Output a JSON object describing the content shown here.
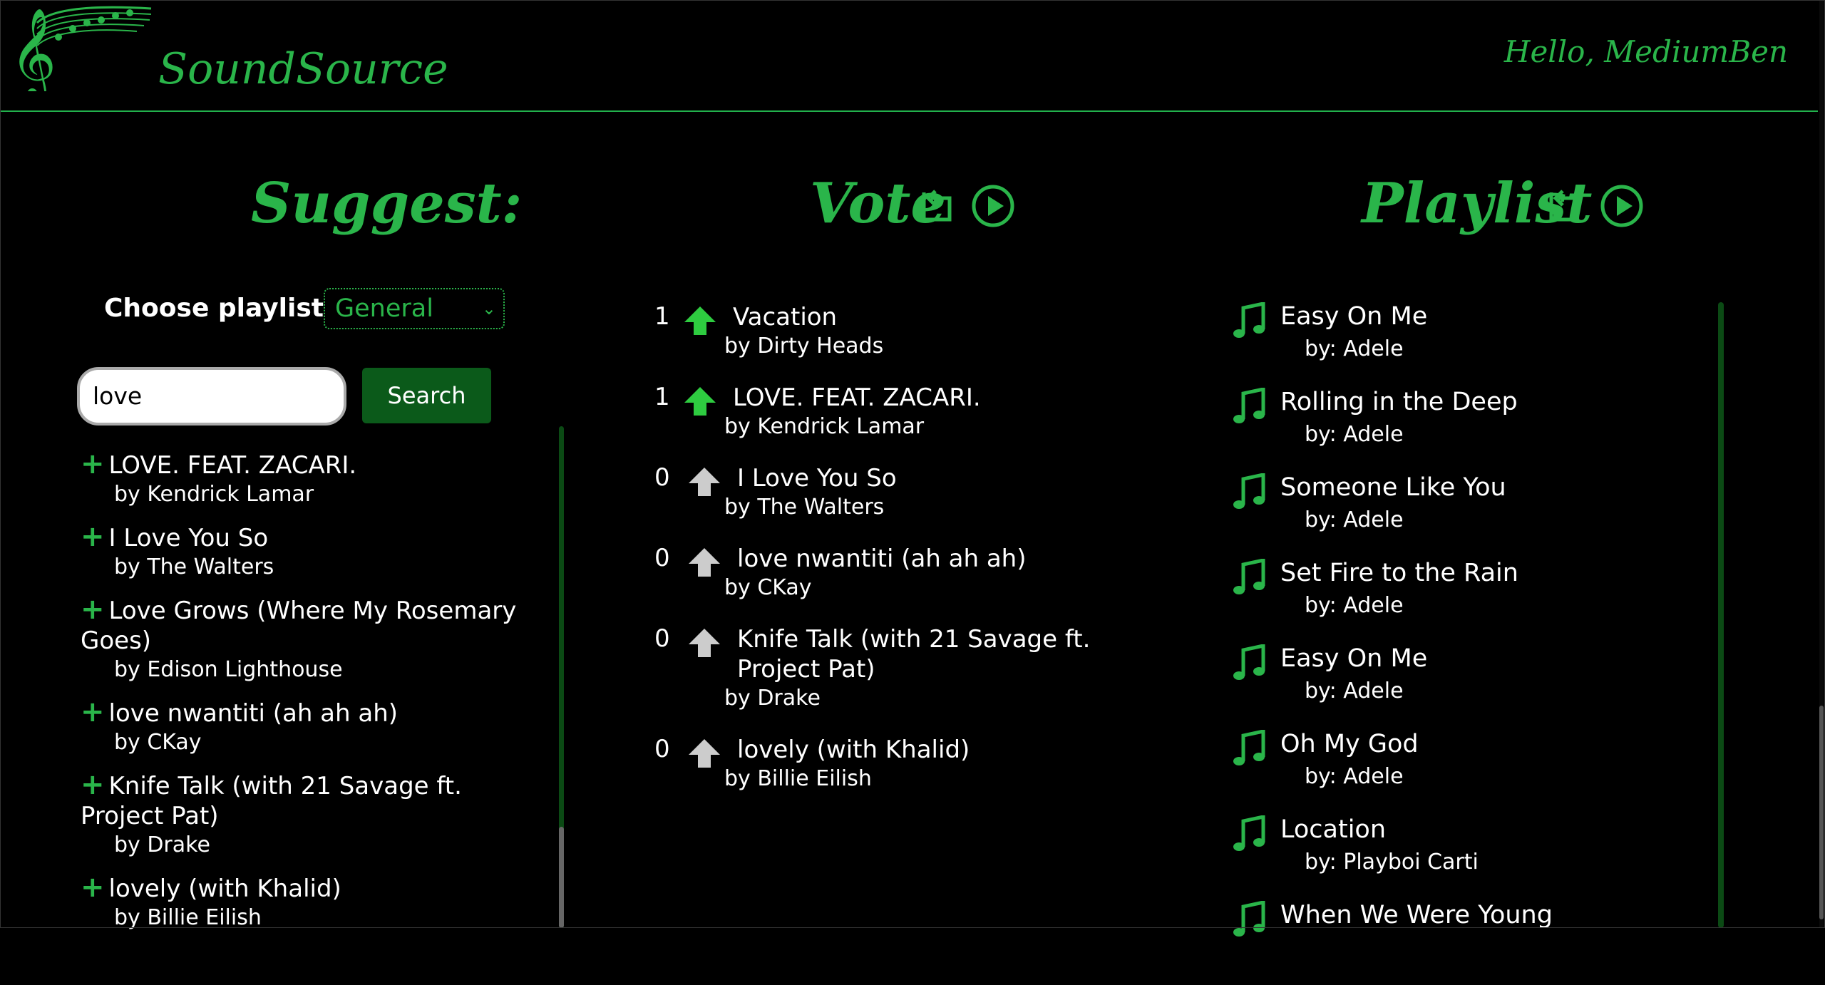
{
  "header": {
    "app_title": "SoundSource",
    "greeting": "Hello, MediumBen"
  },
  "suggest": {
    "title": "Suggest:",
    "playlist_label": "Choose playlist:",
    "playlist_selected": "General",
    "search_value": "love",
    "search_button": "Search",
    "results": [
      {
        "title": "LOVE. FEAT. ZACARI.",
        "artist": "by Kendrick Lamar"
      },
      {
        "title": "I Love You So",
        "artist": "by The Walters"
      },
      {
        "title": "Love Grows (Where My Rosemary Goes)",
        "artist": "by Edison Lighthouse"
      },
      {
        "title": "love nwantiti (ah ah ah)",
        "artist": "by CKay"
      },
      {
        "title": "Knife Talk (with 21 Savage ft. Project Pat)",
        "artist": "by Drake"
      },
      {
        "title": "lovely (with Khalid)",
        "artist": "by Billie Eilish"
      }
    ]
  },
  "vote": {
    "title": "Vote",
    "items": [
      {
        "count": "1",
        "title": "Vacation",
        "artist": "by Dirty Heads",
        "voted": true
      },
      {
        "count": "1",
        "title": "LOVE. FEAT. ZACARI.",
        "artist": "by Kendrick Lamar",
        "voted": true
      },
      {
        "count": "0",
        "title": "I Love You So",
        "artist": "by The Walters",
        "voted": false
      },
      {
        "count": "0",
        "title": "love nwantiti (ah ah ah)",
        "artist": "by CKay",
        "voted": false
      },
      {
        "count": "0",
        "title": "Knife Talk (with 21 Savage ft. Project Pat)",
        "artist": "by Drake",
        "voted": false
      },
      {
        "count": "0",
        "title": "lovely (with Khalid)",
        "artist": "by Billie Eilish",
        "voted": false
      }
    ]
  },
  "playlist": {
    "title": "Playlist",
    "items": [
      {
        "title": "Easy On Me",
        "artist": "by: Adele"
      },
      {
        "title": "Rolling in the Deep",
        "artist": "by: Adele"
      },
      {
        "title": "Someone Like You",
        "artist": "by: Adele"
      },
      {
        "title": "Set Fire to the Rain",
        "artist": "by: Adele"
      },
      {
        "title": "Easy On Me",
        "artist": "by: Adele"
      },
      {
        "title": "Oh My God",
        "artist": "by: Adele"
      },
      {
        "title": "Location",
        "artist": "by: Playboi Carti"
      },
      {
        "title": "When We Were Young",
        "artist": ""
      }
    ]
  },
  "icons": {
    "logo": "treble-clef-music-notes-logo",
    "refresh": "refresh-icon",
    "play": "play-circle-icon",
    "upvote": "upvote-arrow-icon",
    "add": "plus-icon",
    "song": "music-note-icon"
  },
  "colors": {
    "accent": "#2ab54a",
    "button": "#0b5a1a",
    "upvoted": "#2ecc40",
    "not_voted": "#cccccc"
  }
}
